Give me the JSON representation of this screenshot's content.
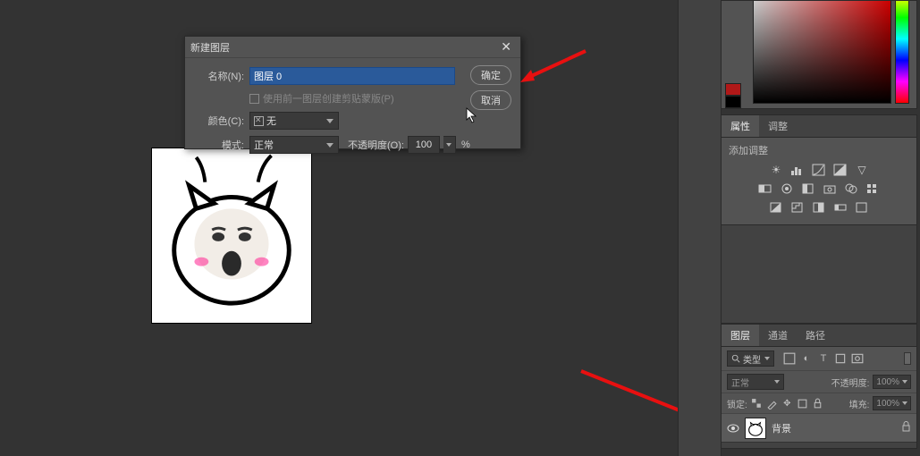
{
  "dialog": {
    "title": "新建图层",
    "name_label": "名称(N):",
    "name_value": "图层 0",
    "clip_checkbox_label": "使用前一图层创建剪贴蒙版(P)",
    "color_label": "颜色(C):",
    "color_value": "无",
    "mode_label": "模式:",
    "mode_value": "正常",
    "opacity_label": "不透明度(O):",
    "opacity_value": "100",
    "percent": "%",
    "ok": "确定",
    "cancel": "取消"
  },
  "props": {
    "tab_properties": "属性",
    "tab_adjust": "调整",
    "subtitle": "添加调整"
  },
  "layers": {
    "tab_layers": "图层",
    "tab_channels": "通道",
    "tab_paths": "路径",
    "search_label": "类型",
    "blend_mode": "正常",
    "opacity_label": "不透明度:",
    "opacity_value": "100%",
    "lock_label": "锁定:",
    "fill_label": "填充:",
    "fill_value": "100%",
    "layer0_name": "背景"
  }
}
